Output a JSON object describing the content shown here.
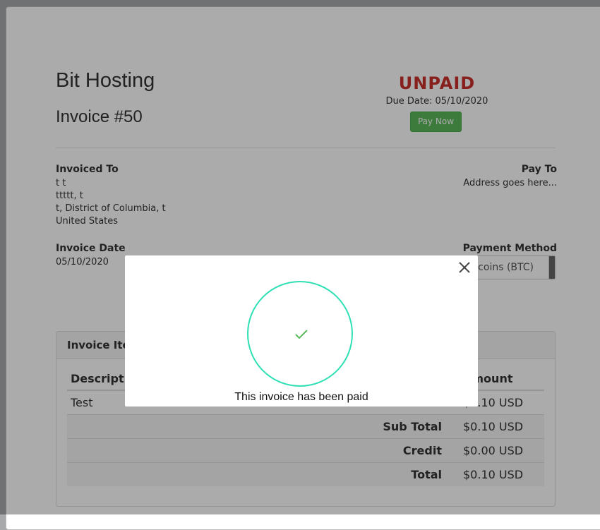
{
  "header": {
    "company": "Bit Hosting",
    "invoice_number": "Invoice #50",
    "status": "UNPAID",
    "due_date": "Due Date: 05/10/2020",
    "pay_now_label": "Pay Now"
  },
  "invoiced_to": {
    "label": "Invoiced To",
    "lines": [
      "t t",
      "ttttt, t",
      "t, District of Columbia, t",
      "United States"
    ]
  },
  "pay_to": {
    "label": "Pay To",
    "text": "Address goes here..."
  },
  "invoice_date": {
    "label": "Invoice Date",
    "value": "05/10/2020"
  },
  "payment_method": {
    "label": "Payment Method",
    "selected": "Bitcoins (BTC)"
  },
  "items_panel": {
    "title": "Invoice Items",
    "columns": [
      "Description",
      "Amount"
    ],
    "rows": [
      {
        "description": "Test",
        "amount": "$0.10 USD"
      }
    ],
    "summary": [
      {
        "label": "Sub Total",
        "amount": "$0.10 USD"
      },
      {
        "label": "Credit",
        "amount": "$0.00 USD"
      },
      {
        "label": "Total",
        "amount": "$0.10 USD"
      }
    ]
  },
  "modal": {
    "message": "This invoice has been paid",
    "close_icon": "close-icon",
    "success_icon": "checkmark-icon",
    "accent_color": "#2ee0b4",
    "check_color": "#5cb85c"
  },
  "colors": {
    "status_unpaid": "#c9302c",
    "pay_button": "#5cb85c"
  }
}
